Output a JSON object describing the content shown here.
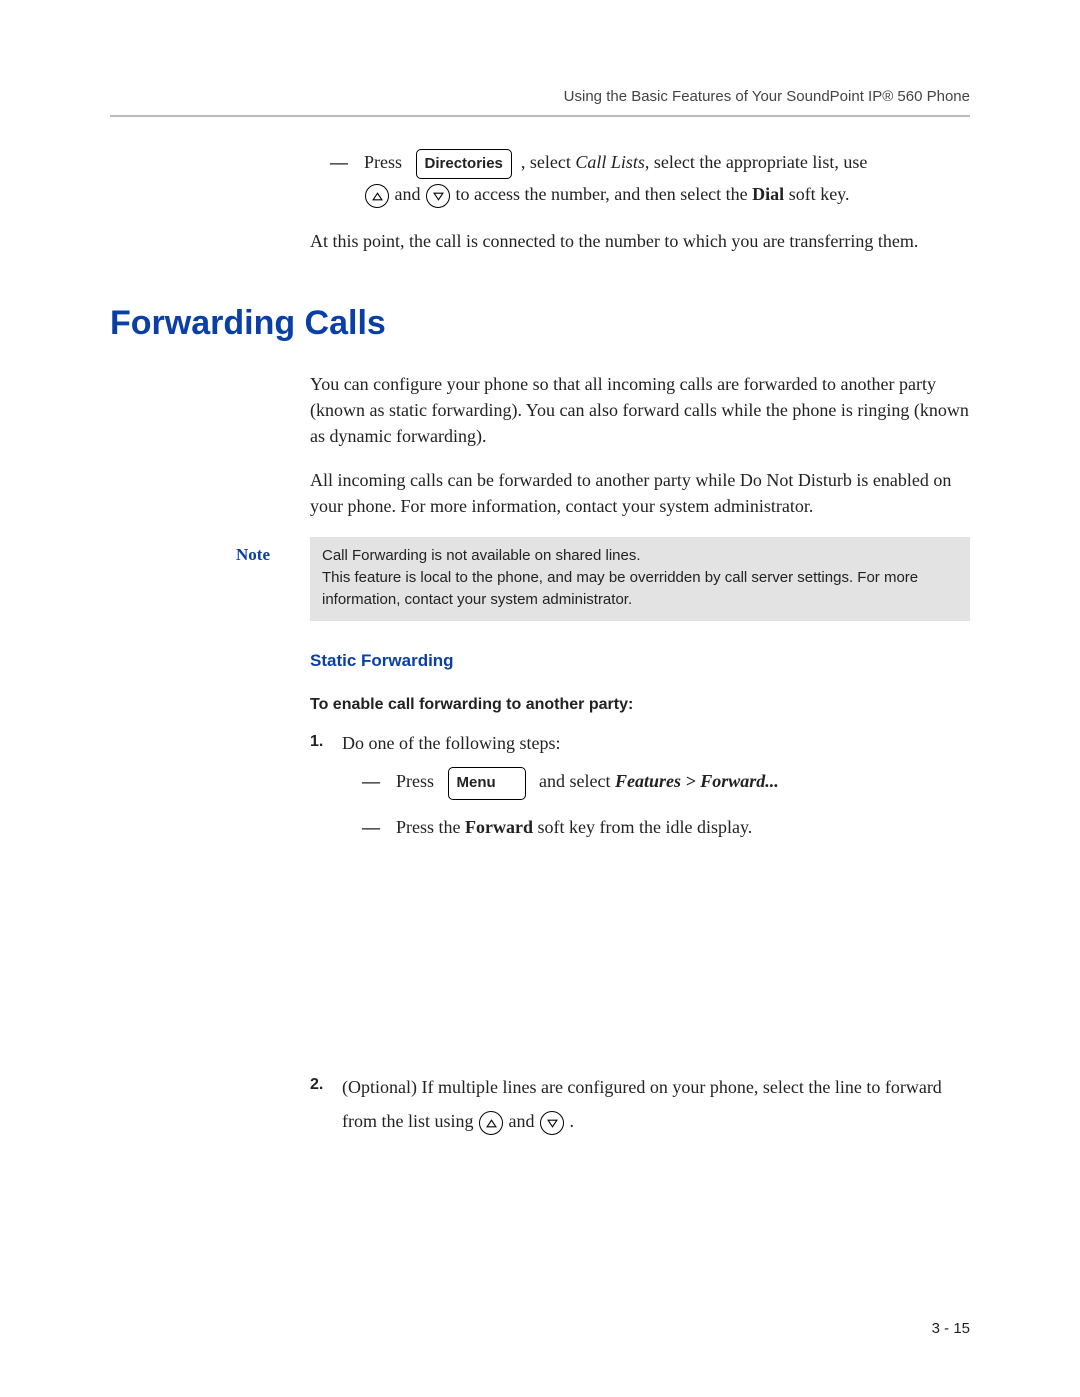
{
  "header": "Using the Basic Features of Your SoundPoint IP® 560 Phone",
  "intro": {
    "press": "Press",
    "directories_key": "Directories",
    "select_text": ", select ",
    "call_lists": "Call Lists",
    "select_appropriate": ", select the appropriate list, use",
    "and": " and ",
    "access_number": " to access the number, and then select the ",
    "dial": "Dial",
    "soft_key": " soft key.",
    "connected": "At this point, the call is connected to the number to which you are transferring them."
  },
  "section_title": "Forwarding Calls",
  "forwarding": {
    "p1": "You can configure your phone so that all incoming calls are forwarded to another party (known as static forwarding). You can also forward calls while the phone is ringing (known as dynamic forwarding).",
    "p2": "All incoming calls can be forwarded to another party while Do Not Disturb is enabled on your phone. For more information, contact your system administrator."
  },
  "note": {
    "label": "Note",
    "line1": "Call Forwarding is not available on shared lines.",
    "line2": "This feature is local to the phone, and may be overridden by call server settings. For more information, contact your system administrator."
  },
  "static_heading": "Static Forwarding",
  "enable_heading": "To enable call forwarding to another party:",
  "steps": {
    "s1_num": "1.",
    "s1_text": "Do one of the following steps:",
    "s1a_press": "Press",
    "s1a_menu_key": "Menu",
    "s1a_and_select": " and select ",
    "s1a_features": "Features > Forward...",
    "s1b_pre": "Press the ",
    "s1b_forward": "Forward",
    "s1b_post": " soft key from the idle display.",
    "s2_num": "2.",
    "s2_pre": "(Optional) If multiple lines are configured on your phone, select the line to forward from the list using ",
    "s2_and": " and ",
    "s2_period": "."
  },
  "footer": "3 - 15"
}
